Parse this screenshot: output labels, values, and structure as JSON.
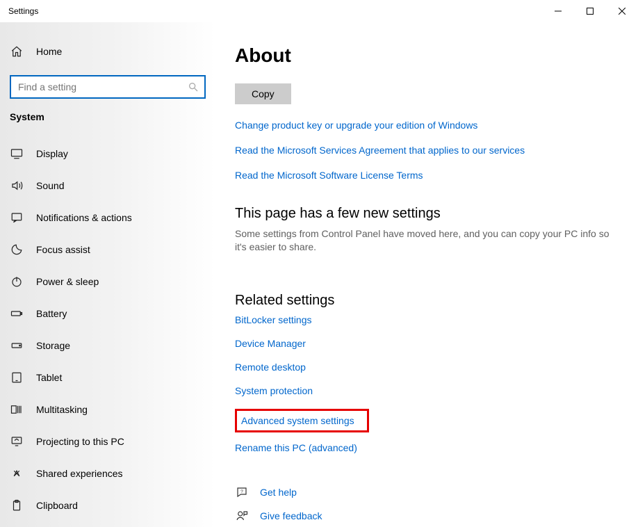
{
  "window": {
    "title": "Settings"
  },
  "sidebar": {
    "home_label": "Home",
    "search_placeholder": "Find a setting",
    "section_label": "System",
    "items": [
      {
        "label": "Display"
      },
      {
        "label": "Sound"
      },
      {
        "label": "Notifications & actions"
      },
      {
        "label": "Focus assist"
      },
      {
        "label": "Power & sleep"
      },
      {
        "label": "Battery"
      },
      {
        "label": "Storage"
      },
      {
        "label": "Tablet"
      },
      {
        "label": "Multitasking"
      },
      {
        "label": "Projecting to this PC"
      },
      {
        "label": "Shared experiences"
      },
      {
        "label": "Clipboard"
      }
    ]
  },
  "main": {
    "title": "About",
    "copy_label": "Copy",
    "links_top": [
      "Change product key or upgrade your edition of Windows",
      "Read the Microsoft Services Agreement that applies to our services",
      "Read the Microsoft Software License Terms"
    ],
    "new_settings_heading": "This page has a few new settings",
    "new_settings_desc": "Some settings from Control Panel have moved here, and you can copy your PC info so it's easier to share.",
    "related_heading": "Related settings",
    "related_links": [
      "BitLocker settings",
      "Device Manager",
      "Remote desktop",
      "System protection",
      "Advanced system settings",
      "Rename this PC (advanced)"
    ],
    "help": {
      "get_help": "Get help",
      "feedback": "Give feedback"
    }
  }
}
